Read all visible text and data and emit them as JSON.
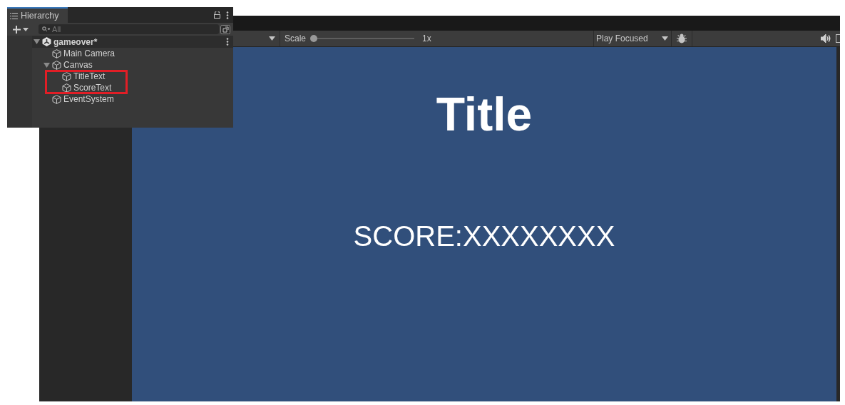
{
  "game_view": {
    "toolbar": {
      "scale_label": "Scale",
      "scale_slider": {
        "level": 0
      },
      "scale_value": "1x",
      "play_mode": "Play Focused"
    },
    "title": "Title",
    "score": "SCORE:XXXXXXXX"
  },
  "hierarchy": {
    "tab": "Hierarchy",
    "search": {
      "placeholder": "All"
    },
    "tree": [
      {
        "kind": "scene",
        "label": "gameover*",
        "expanded": true,
        "children": [
          {
            "kind": "object",
            "label": "Main Camera"
          },
          {
            "kind": "object",
            "label": "Canvas",
            "expanded": true,
            "children": [
              {
                "kind": "object",
                "label": "TitleText"
              },
              {
                "kind": "object",
                "label": "ScoreText"
              }
            ]
          },
          {
            "kind": "object",
            "label": "EventSystem"
          }
        ]
      }
    ]
  }
}
